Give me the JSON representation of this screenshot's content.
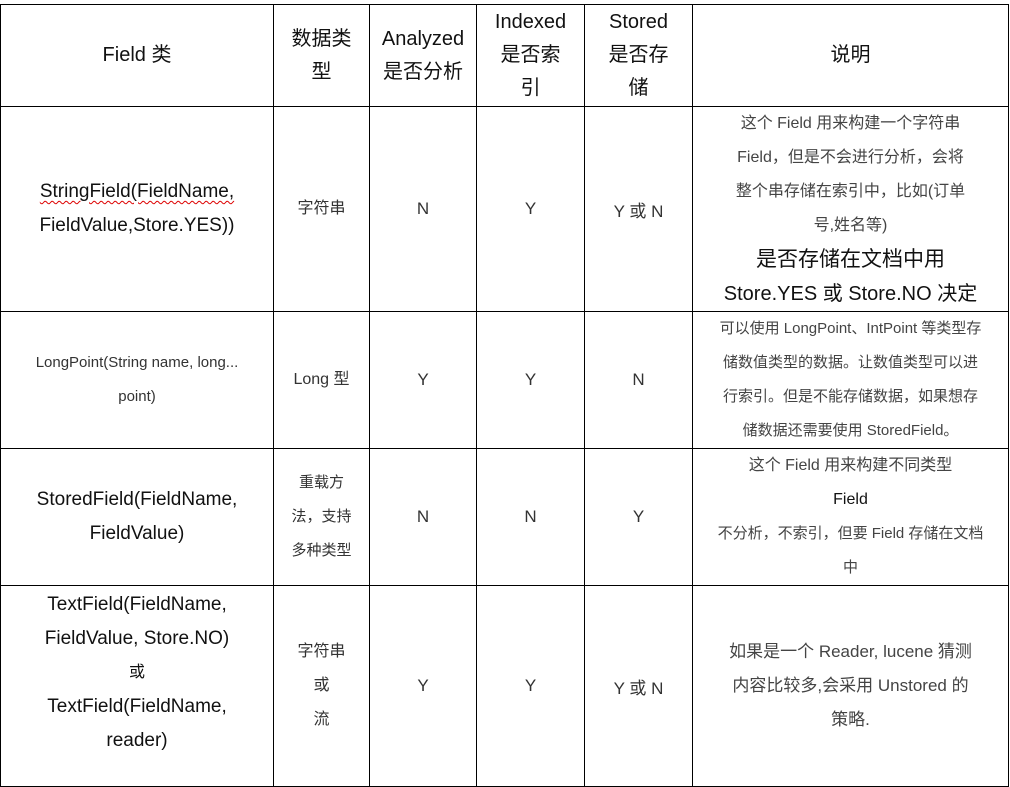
{
  "table": {
    "headers": {
      "field_class": "Field 类",
      "data_type": [
        "数据类",
        "型"
      ],
      "analyzed": [
        "Analyzed",
        "是否分析"
      ],
      "indexed": [
        "Indexed",
        "是否索",
        "引"
      ],
      "stored": [
        "Stored",
        "是否存",
        "储"
      ],
      "description": "说明"
    },
    "rows": [
      {
        "field_class": [
          "StringField(FieldName,",
          "FieldValue,Store.YES))"
        ],
        "data_type": [
          "字符串"
        ],
        "analyzed": "N",
        "indexed": "Y",
        "stored": "Y 或 N",
        "description": [
          "这个 Field 用来构建一个字符串",
          "Field，但是不会进行分析，会将",
          "整个串存储在索引中，比如(订单",
          "号,姓名等)",
          "是否存储在文档中用",
          "Store.YES 或 Store.NO 决定"
        ]
      },
      {
        "field_class": [
          "LongPoint(String name, long...",
          "point)"
        ],
        "data_type": [
          "Long 型"
        ],
        "analyzed": "Y",
        "indexed": "Y",
        "stored": "N",
        "description": [
          "可以使用 LongPoint、IntPoint 等类型存",
          "储数值类型的数据。让数值类型可以进",
          "行索引。但是不能存储数据，如果想存",
          "储数据还需要使用 StoredField。"
        ]
      },
      {
        "field_class": [
          "StoredField(FieldName,",
          "FieldValue)"
        ],
        "data_type": [
          "重载方",
          "法，支持",
          "多种类型"
        ],
        "analyzed": "N",
        "indexed": "N",
        "stored": "Y",
        "description": [
          "这个 Field 用来构建不同类型",
          "Field",
          "不分析，不索引，但要 Field 存储在文档",
          "中"
        ]
      },
      {
        "field_class": [
          "TextField(FieldName,",
          "FieldValue, Store.NO)",
          "或",
          "TextField(FieldName,",
          "reader)"
        ],
        "data_type": [
          "字符串",
          "或",
          "流"
        ],
        "analyzed": "Y",
        "indexed": "Y",
        "stored": "Y 或 N",
        "description": [
          "如果是一个 Reader, lucene 猜测",
          "内容比较多,会采用 Unstored 的",
          "策略."
        ]
      }
    ]
  }
}
